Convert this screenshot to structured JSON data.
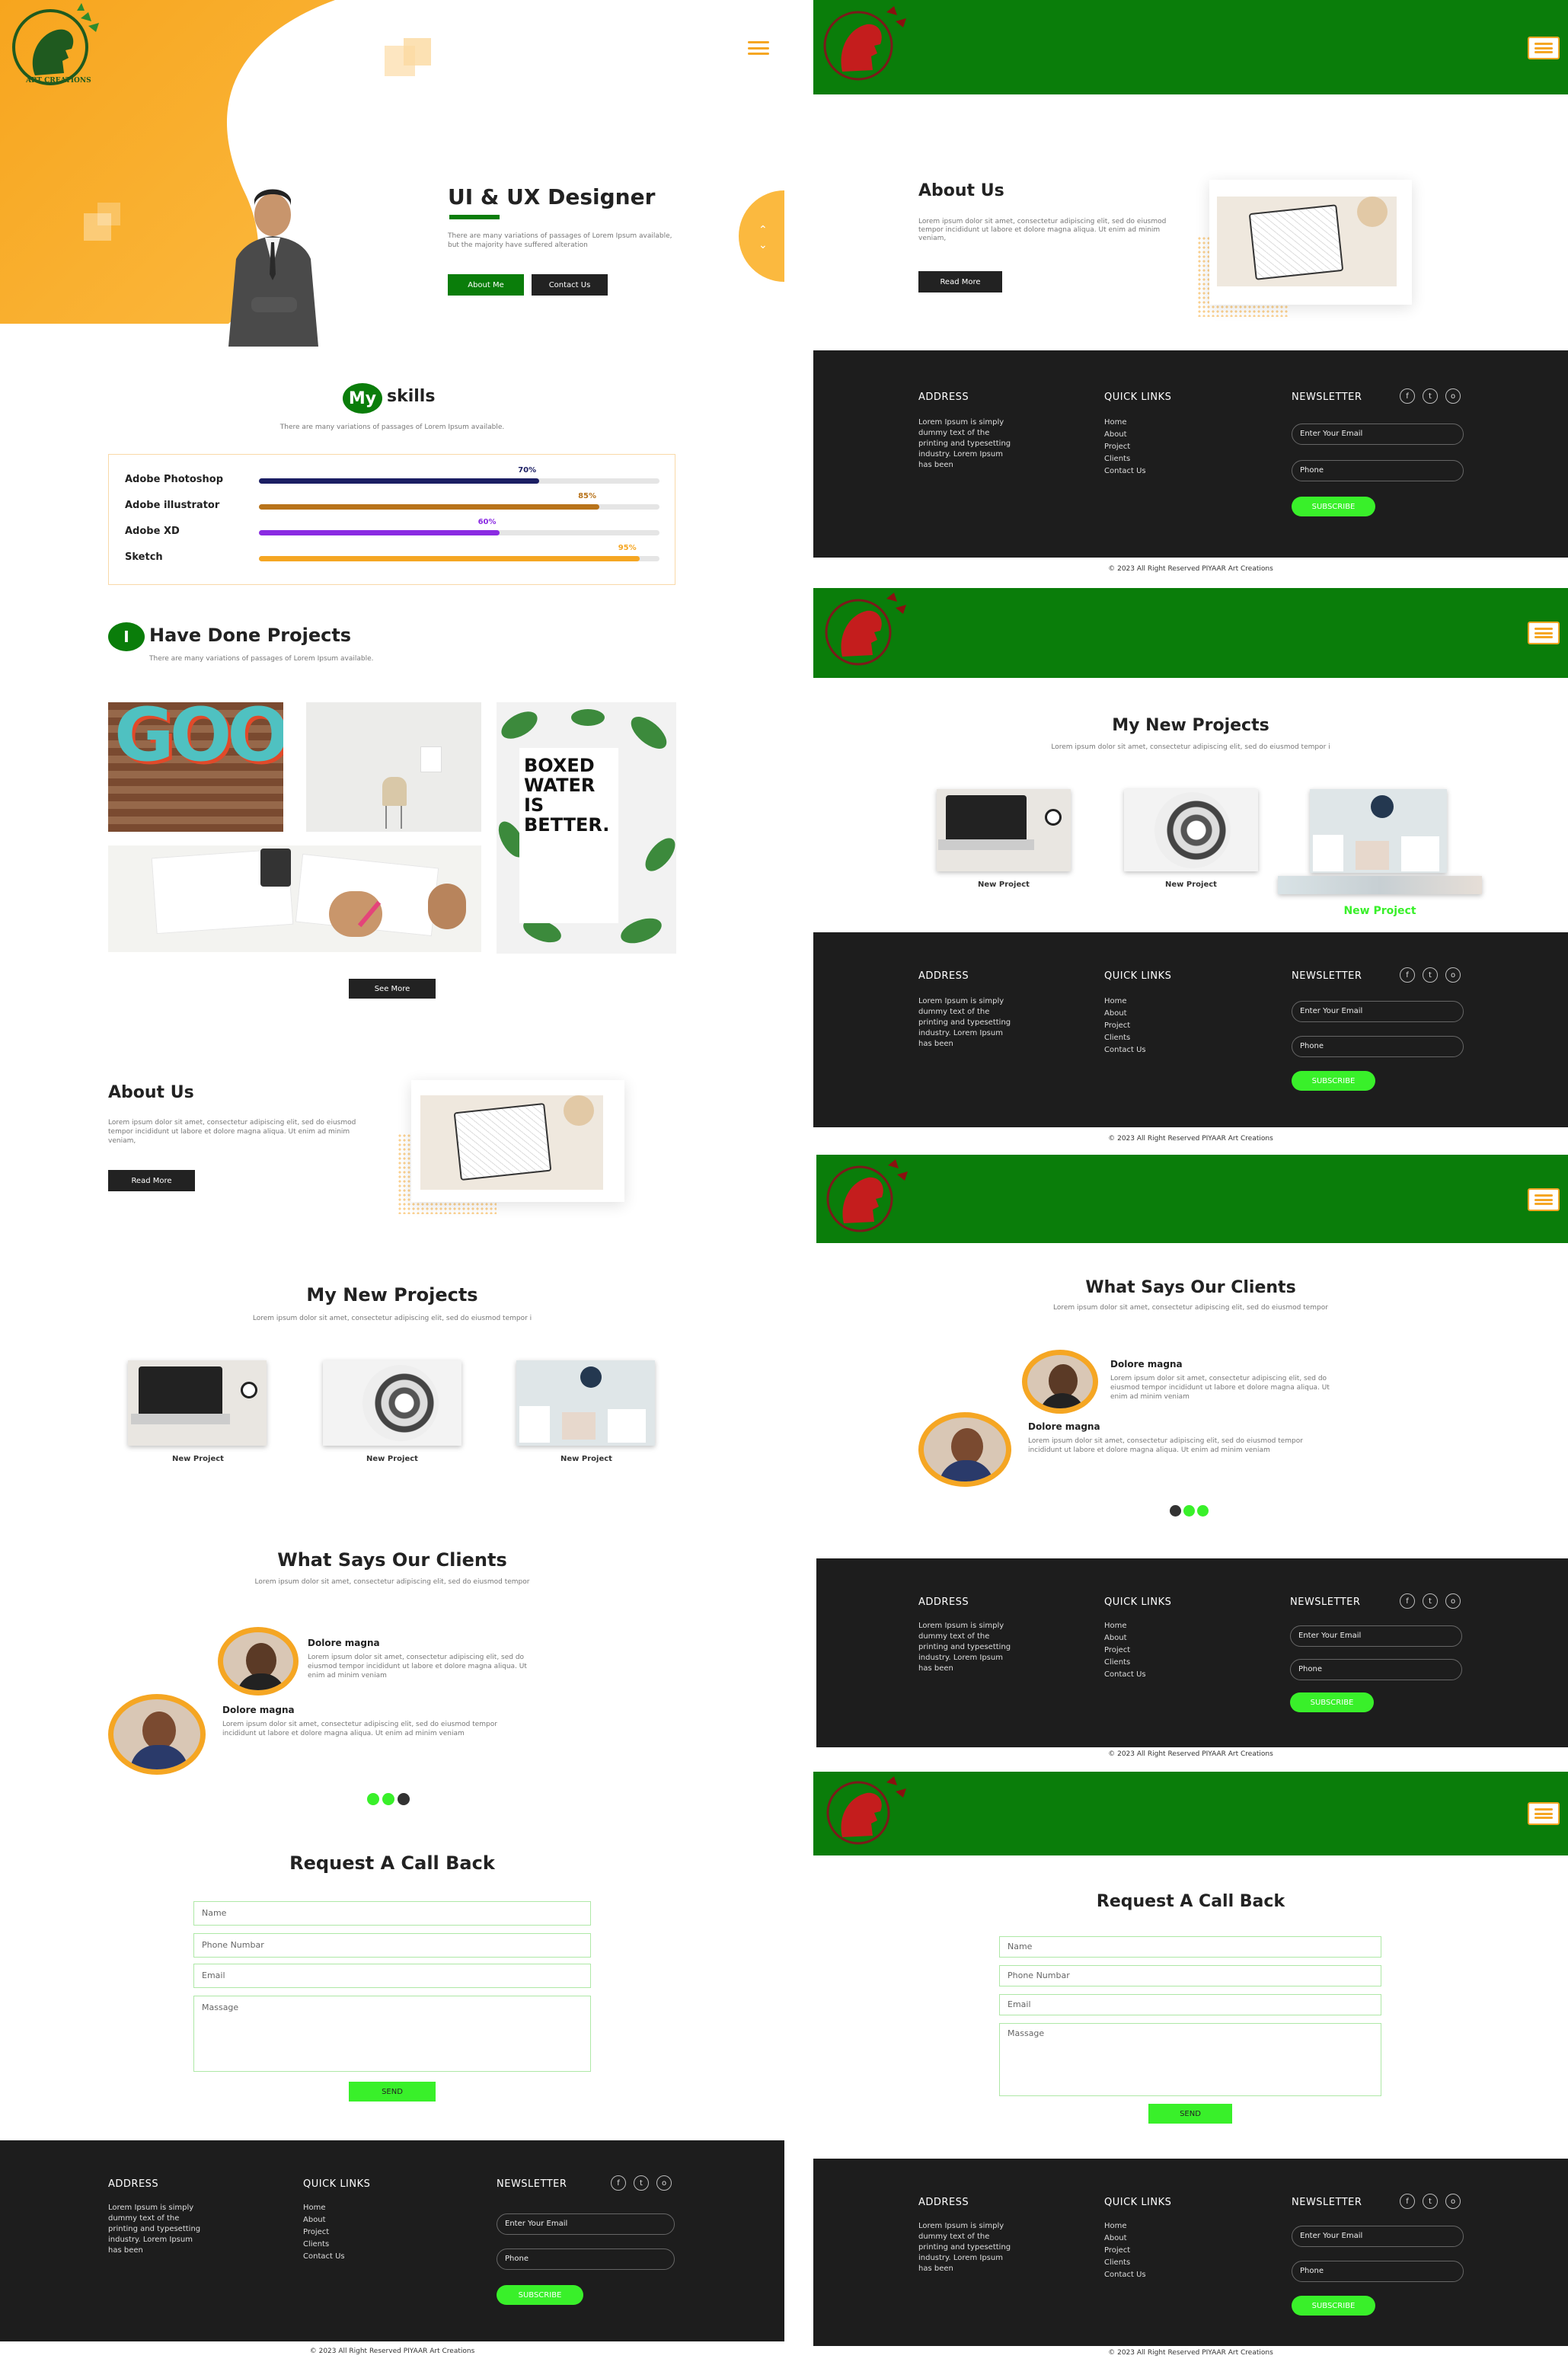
{
  "hero": {
    "title": "UI & UX Designer",
    "desc": "There are many variations of passages of Lorem Ipsum available, but the majority have suffered alteration",
    "btn_about": "About Me",
    "btn_contact": "Contact Us"
  },
  "skills": {
    "title_badge": "My",
    "title": "skills",
    "subtitle": "There are many variations of passages of Lorem Ipsum available.",
    "items": [
      {
        "name": "Adobe Photoshop",
        "percent": 70,
        "label": "70%",
        "color": "#1b1e63"
      },
      {
        "name": "Adobe illustrator",
        "percent": 85,
        "label": "85%",
        "color": "#b8731a"
      },
      {
        "name": "Adobe XD",
        "percent": 60,
        "label": "60%",
        "color": "#8a2be2"
      },
      {
        "name": "Sketch",
        "percent": 95,
        "label": "95%",
        "color": "#f5a623"
      }
    ]
  },
  "projects": {
    "badge": "I",
    "title": "Have Done Projects",
    "subtitle": "There are many variations of passages of Lorem Ipsum available.",
    "gallery_text_good": "GOOD",
    "gallery_text_water": "BOXED WATER IS BETTER.",
    "see_more": "See More"
  },
  "about": {
    "title": "About Us",
    "desc": "Lorem ipsum dolor sit amet, consectetur adipiscing elit, sed do eiusmod tempor incididunt ut labore et dolore magna aliqua. Ut enim ad minim veniam,",
    "read_more": "Read More"
  },
  "new_projects": {
    "title": "My New Projects",
    "subtitle": "Lorem ipsum dolor sit amet, consectetur adipiscing elit, sed do eiusmod tempor i",
    "item_label": "New Project"
  },
  "clients": {
    "title": "What Says Our Clients",
    "subtitle": "Lorem ipsum dolor sit amet, consectetur adipiscing elit, sed do eiusmod tempor",
    "name": "Dolore magna",
    "text": "Lorem ipsum dolor sit amet, consectetur adipiscing elit, sed do eiusmod tempor incididunt ut labore et dolore magna aliqua. Ut enim ad minim veniam"
  },
  "callback": {
    "title": "Request A Call Back",
    "name": "Name",
    "phone": "Phone Numbar",
    "email": "Email",
    "message": "Massage",
    "send": "SEND"
  },
  "footer": {
    "address_title": "ADDRESS",
    "address_text": "Lorem Ipsum is simply dummy text of the printing and typesetting industry. Lorem Ipsum has been",
    "links_title": "QUICK LINKS",
    "links": [
      "Home",
      "About",
      "Project",
      "Clients",
      "Contact Us"
    ],
    "newsletter_title": "NEWSLETTER",
    "email_placeholder": "Enter Your Email",
    "phone_placeholder": "Phone",
    "subscribe": "SUBSCRIBE",
    "social": [
      "f",
      "t",
      "o"
    ],
    "copyright": "© 2023 All Right Reserved PIYAAR Art Creations"
  },
  "logo_text": "ART CREATIONS",
  "colors": {
    "brand_green": "#0a7d0a",
    "accent_orange": "#f5a623",
    "lime": "#39f02a",
    "footer_bg": "#1d1d1d"
  }
}
